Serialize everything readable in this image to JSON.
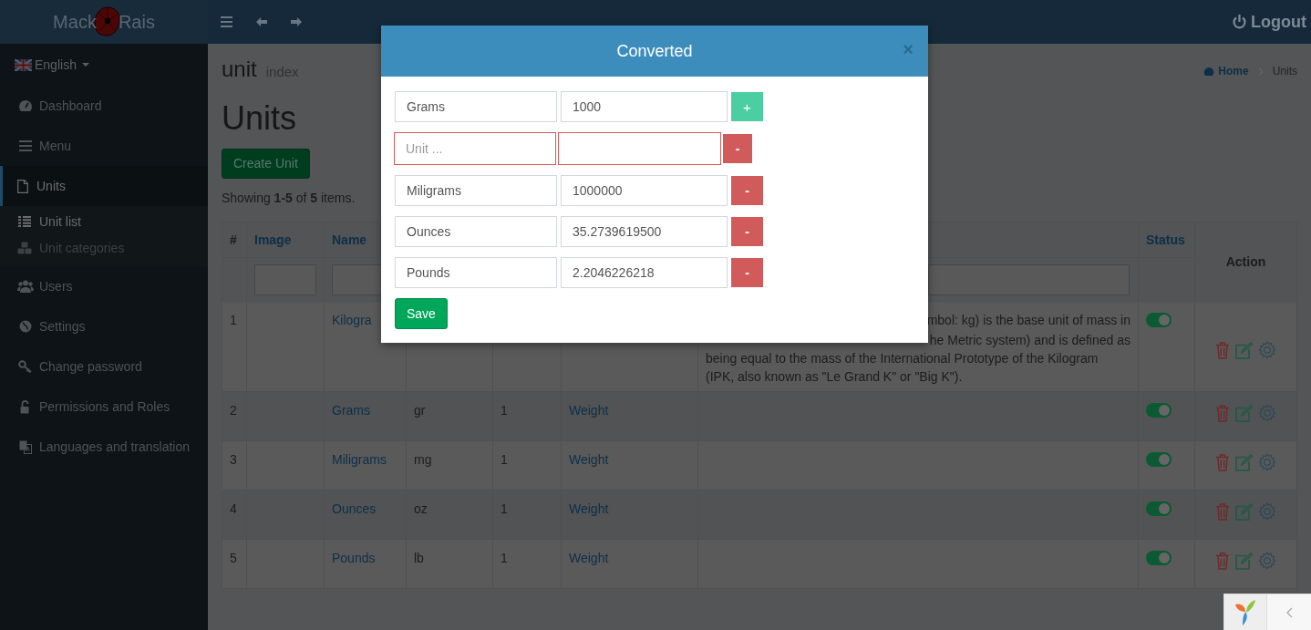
{
  "brand": {
    "first": "Mack",
    "second": "Rais"
  },
  "topbar": {
    "logout": "Logout"
  },
  "sidebar": {
    "language": "English",
    "items": [
      {
        "label": "Dashboard",
        "selected": false
      },
      {
        "label": "Menu",
        "selected": false
      },
      {
        "label": "Units",
        "selected": true,
        "expanded": true,
        "children": [
          {
            "label": "Unit list",
            "selected": true
          },
          {
            "label": "Unit categories",
            "selected": false
          }
        ]
      },
      {
        "label": "Users",
        "selected": false
      },
      {
        "label": "Settings",
        "selected": false
      },
      {
        "label": "Change password",
        "selected": false
      },
      {
        "label": "Permissions and Roles",
        "selected": false
      },
      {
        "label": "Languages and translation",
        "selected": false
      }
    ]
  },
  "header": {
    "title": "unit",
    "subtitle": "index",
    "breadcrumb": [
      {
        "label": "Home",
        "kind": "link"
      },
      {
        "label": "Units",
        "kind": "current"
      }
    ]
  },
  "heading": "Units",
  "create_button": "Create Unit",
  "summary": "Showing **1-5** of **5** items.",
  "table": {
    "columns": [
      {
        "label": "#",
        "kind": "plain"
      },
      {
        "label": "Image",
        "kind": "sort"
      },
      {
        "label": "Name",
        "kind": "sort"
      },
      {
        "label": "Status",
        "kind": "sort"
      },
      {
        "label": "Action",
        "kind": "plain"
      }
    ],
    "rows": [
      {
        "number": "1",
        "name": "Kilogra",
        "description": [
          {
            "text": "mbol: kg) is the base unit of mass in",
            "clipped": true
          },
          {
            "text": "he Metric system) and is defined as",
            "clipped": true
          },
          {
            "text": "being equal to the mass of the International Prototype of the Kilogram",
            "clipped": false
          },
          {
            "text": "(IPK, also known as \"Le Grand K\" or \"Big K\").",
            "clipped": false
          }
        ],
        "active": true
      },
      {
        "number": "2",
        "name": "Grams",
        "symbol": "gr",
        "factor": "1",
        "category": "Weight",
        "active": true
      },
      {
        "number": "3",
        "name": "Miligrams",
        "symbol": "mg",
        "factor": "1",
        "category": "Weight",
        "active": true
      },
      {
        "number": "4",
        "name": "Ounces",
        "symbol": "oz",
        "factor": "1",
        "category": "Weight",
        "active": true
      },
      {
        "number": "5",
        "name": "Pounds",
        "symbol": "lb",
        "factor": "1",
        "category": "Weight",
        "active": true
      }
    ]
  },
  "modal": {
    "title": "Converted",
    "close": "×",
    "rows": [
      {
        "unit": "Grams",
        "value": "1000",
        "invalid": false,
        "button": {
          "kind": "add",
          "label": "+"
        }
      },
      {
        "placeholder": "Unit ...",
        "invalid": true,
        "button": {
          "kind": "remove",
          "label": "-"
        }
      },
      {
        "unit": "Miligrams",
        "value": "1000000",
        "invalid": false,
        "button": {
          "kind": "remove",
          "label": "-"
        }
      },
      {
        "unit": "Ounces",
        "value": "35.2739619500",
        "invalid": false,
        "button": {
          "kind": "remove",
          "label": "-"
        }
      },
      {
        "unit": "Pounds",
        "value": "2.2046226218",
        "invalid": false,
        "button": {
          "kind": "remove",
          "label": "-"
        }
      }
    ],
    "save": "Save"
  }
}
